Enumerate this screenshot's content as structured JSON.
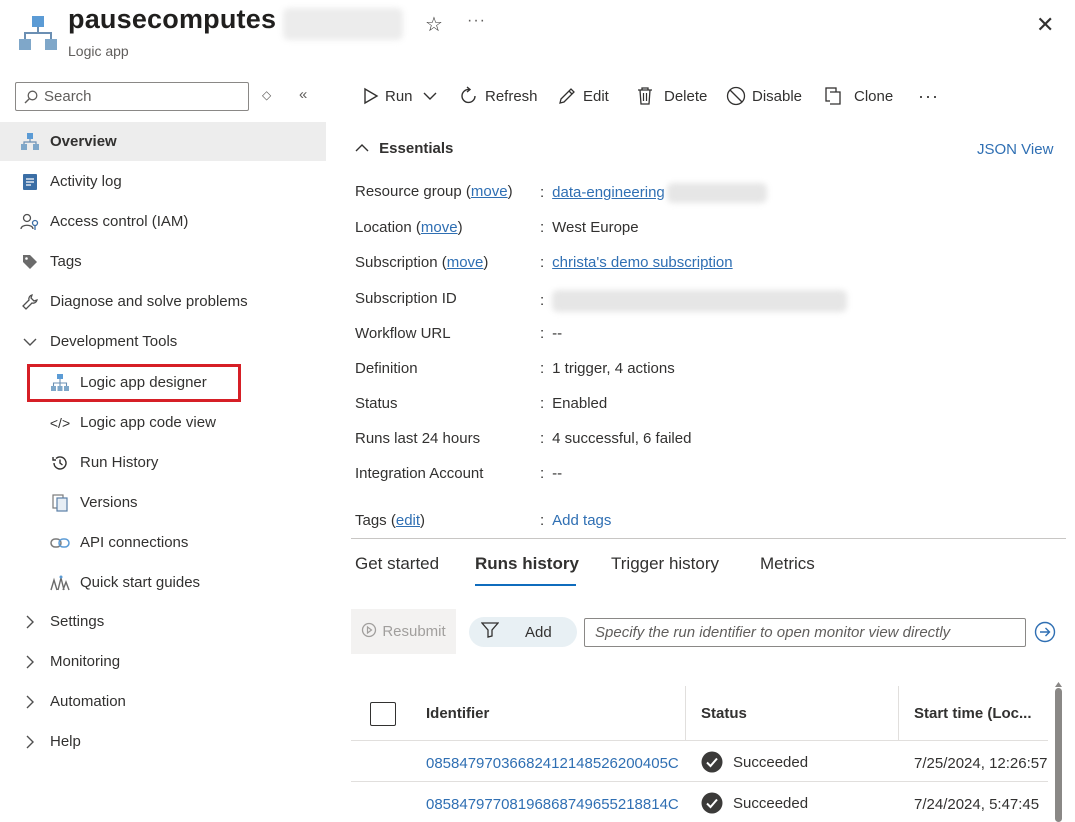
{
  "header": {
    "title": "pausecomputes",
    "subtitle": "Logic app",
    "favorite_icon": "star-icon",
    "more_label": "···",
    "close_icon": "close-icon"
  },
  "sidebar": {
    "search_placeholder": "Search",
    "items": [
      {
        "label": "Overview",
        "icon": "logic-app-icon"
      },
      {
        "label": "Activity log",
        "icon": "activity-log-icon"
      },
      {
        "label": "Access control (IAM)",
        "icon": "iam-icon"
      },
      {
        "label": "Tags",
        "icon": "tag-icon"
      },
      {
        "label": "Diagnose and solve problems",
        "icon": "wrench-icon"
      },
      {
        "label": "Development Tools",
        "icon": "chevron-down-icon"
      },
      {
        "label": "Logic app designer",
        "icon": "designer-icon"
      },
      {
        "label": "Logic app code view",
        "icon": "code-icon"
      },
      {
        "label": "Run History",
        "icon": "history-icon"
      },
      {
        "label": "Versions",
        "icon": "versions-icon"
      },
      {
        "label": "API connections",
        "icon": "link-icon"
      },
      {
        "label": "Quick start guides",
        "icon": "quickstart-icon"
      },
      {
        "label": "Settings",
        "icon": "chevron-right-icon"
      },
      {
        "label": "Monitoring",
        "icon": "chevron-right-icon"
      },
      {
        "label": "Automation",
        "icon": "chevron-right-icon"
      },
      {
        "label": "Help",
        "icon": "chevron-right-icon"
      }
    ]
  },
  "toolbar": {
    "run": "Run",
    "refresh": "Refresh",
    "edit": "Edit",
    "delete": "Delete",
    "disable": "Disable",
    "clone": "Clone",
    "more": "···"
  },
  "essentials": {
    "title": "Essentials",
    "json_view": "JSON View",
    "move": "move",
    "edit": "edit",
    "resource_group_label": "Resource group",
    "resource_group_value": "data-engineering",
    "location_label": "Location",
    "location_value": "West Europe",
    "subscription_label": "Subscription",
    "subscription_value": "christa's demo subscription",
    "subscription_id_label": "Subscription ID",
    "workflow_url_label": "Workflow URL",
    "workflow_url_value": "--",
    "definition_label": "Definition",
    "definition_value": "1 trigger, 4 actions",
    "status_label": "Status",
    "status_value": "Enabled",
    "runs_label": "Runs last 24 hours",
    "runs_value": "4 successful, 6 failed",
    "integration_label": "Integration Account",
    "integration_value": "--",
    "tags_label": "Tags",
    "tags_value": "Add tags"
  },
  "tabs": [
    "Get started",
    "Runs history",
    "Trigger history",
    "Metrics"
  ],
  "runs": {
    "resubmit": "Resubmit",
    "add_filter": "Add",
    "search_placeholder": "Specify the run identifier to open monitor view directly",
    "columns": [
      "Identifier",
      "Status",
      "Start time (Loc..."
    ],
    "rows": [
      {
        "id": "08584797036682412148526200405C",
        "status": "Succeeded",
        "time": "7/25/2024, 12:26:57"
      },
      {
        "id": "08584797708196868749655218814C",
        "status": "Succeeded",
        "time": "7/24/2024, 5:47:45"
      }
    ]
  },
  "colors": {
    "accent": "#0f6cbd",
    "link": "#2f6fb3",
    "highlight_box": "#d61f26",
    "active_nav_bg": "#ededed"
  }
}
